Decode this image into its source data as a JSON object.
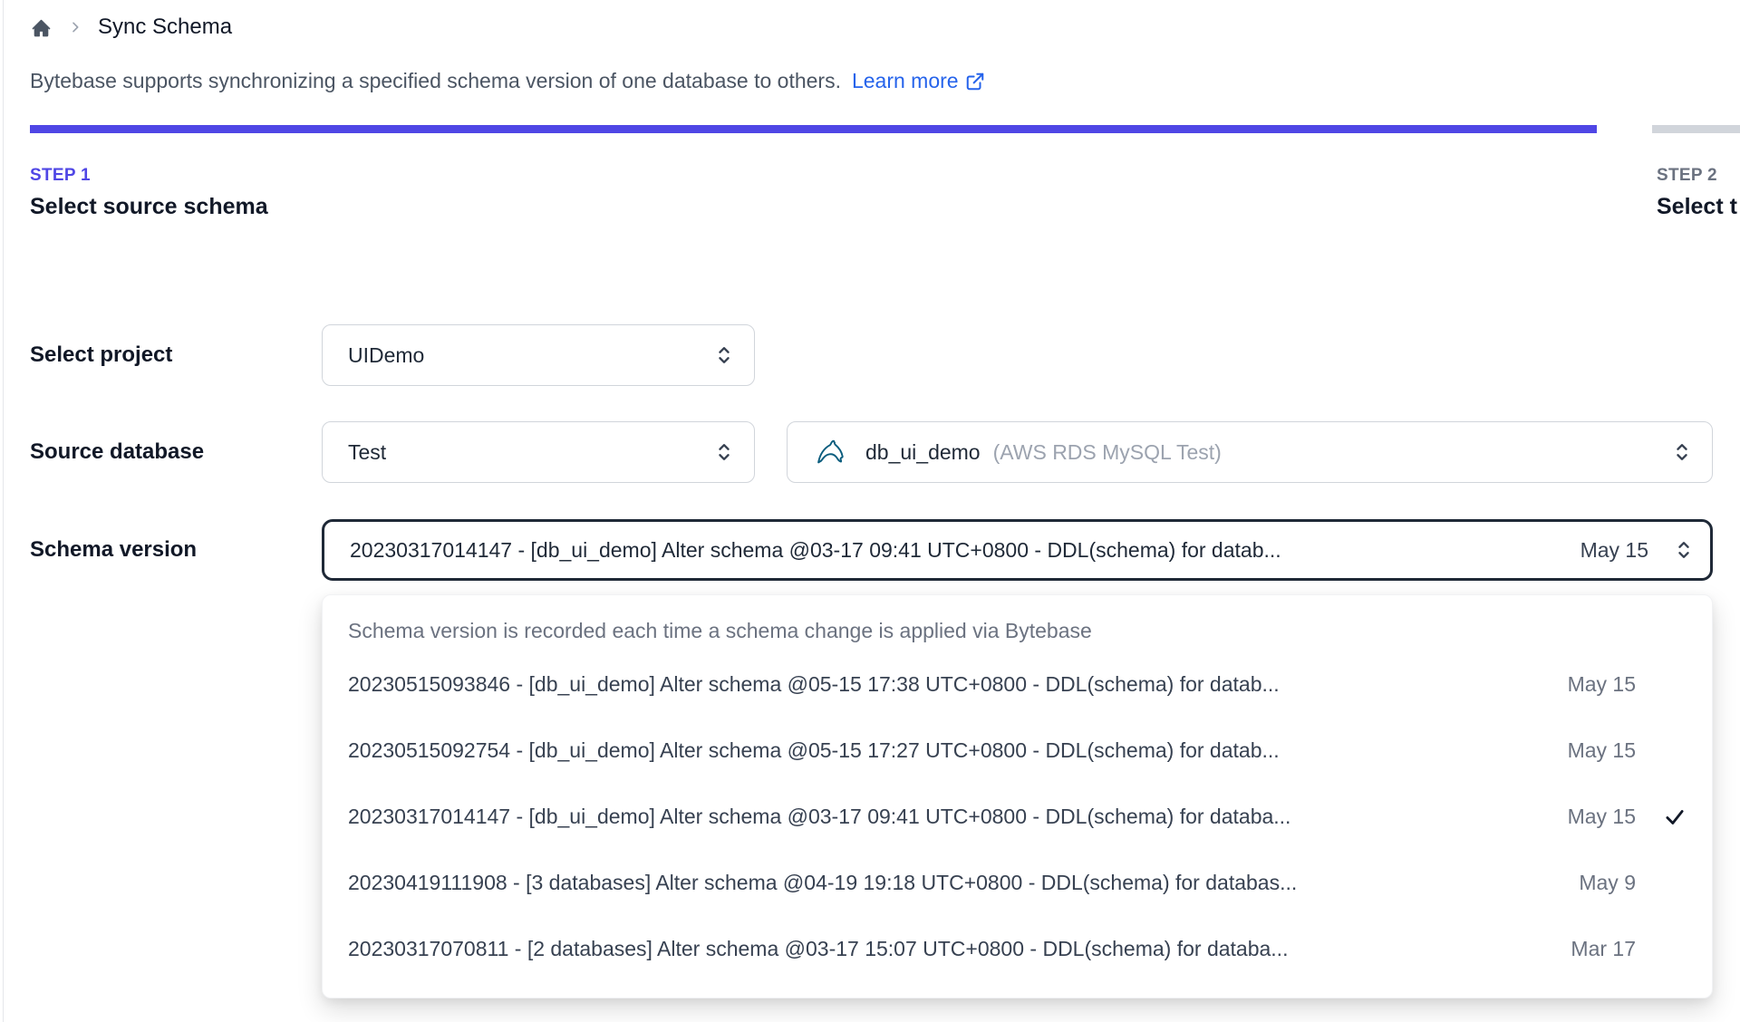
{
  "colors": {
    "accent_indigo": "#4f46e5",
    "link_blue": "#2563eb",
    "bar_inactive": "#d1d5db",
    "focused_border": "#1f2937"
  },
  "breadcrumb": {
    "home_icon": "home-icon",
    "separator_icon": "chevron-right-icon",
    "page_title": "Sync Schema"
  },
  "description": {
    "text": "Bytebase supports synchronizing a specified schema version of one database to others.",
    "link_label": "Learn more",
    "link_icon": "external-link-icon"
  },
  "steps": [
    {
      "label": "STEP 1",
      "title": "Select source schema",
      "state": "active"
    },
    {
      "label": "STEP 2",
      "title": "Select t",
      "state": "upcoming"
    }
  ],
  "form": {
    "project": {
      "label": "Select project",
      "value": "UIDemo"
    },
    "source_database": {
      "label": "Source database",
      "environment_value": "Test",
      "database_icon": "mysql-icon",
      "database_name": "db_ui_demo",
      "database_engine": "(AWS RDS MySQL Test)"
    },
    "schema_version": {
      "label": "Schema version",
      "value": "20230317014147 - [db_ui_demo] Alter schema @03-17 09:41 UTC+0800 - DDL(schema) for datab...",
      "value_date": "May 15"
    }
  },
  "dropdown": {
    "hint": "Schema version is recorded each time a schema change is applied via Bytebase",
    "items": [
      {
        "text": "20230515093846 - [db_ui_demo] Alter schema @05-15 17:38 UTC+0800 - DDL(schema) for datab...",
        "date": "May 15",
        "selected": false
      },
      {
        "text": "20230515092754 - [db_ui_demo] Alter schema @05-15 17:27 UTC+0800 - DDL(schema) for datab...",
        "date": "May 15",
        "selected": false
      },
      {
        "text": "20230317014147 - [db_ui_demo] Alter schema @03-17 09:41 UTC+0800 - DDL(schema) for databa...",
        "date": "May 15",
        "selected": true
      },
      {
        "text": "20230419111908 - [3 databases] Alter schema @04-19 19:18 UTC+0800 - DDL(schema) for databas...",
        "date": "May 9",
        "selected": false
      },
      {
        "text": "20230317070811 - [2 databases] Alter schema @03-17 15:07 UTC+0800 - DDL(schema) for databa...",
        "date": "Mar 17",
        "selected": false
      }
    ]
  }
}
